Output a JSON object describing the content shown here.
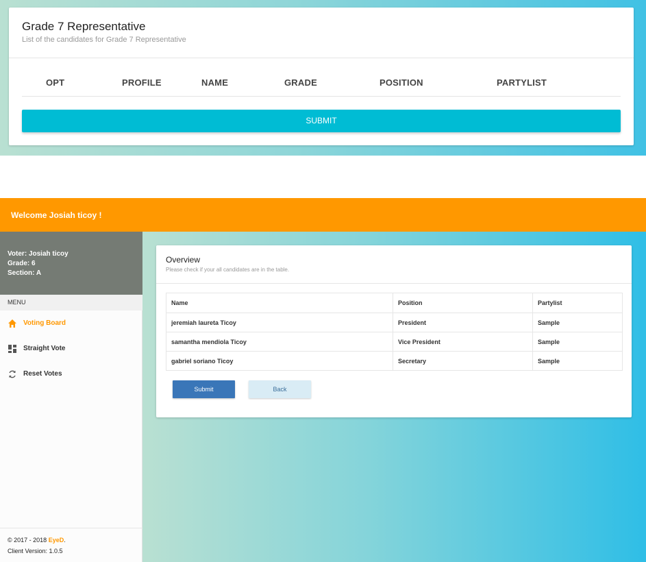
{
  "candidates_card": {
    "title": "Grade 7 Representative",
    "subtitle": "List of the candidates for Grade 7 Representative",
    "columns": [
      "OPT",
      "PROFILE",
      "NAME",
      "GRADE",
      "POSITION",
      "PARTYLIST"
    ],
    "submit_label": "SUBMIT"
  },
  "header": {
    "welcome": "Welcome Josiah ticoy !"
  },
  "sidebar": {
    "voter": "Voter: Josiah ticoy",
    "grade": "Grade: 6",
    "section": "Section: A",
    "menu_label": "MENU",
    "items": [
      {
        "label": "Voting Board",
        "icon": "home-icon",
        "active": true
      },
      {
        "label": "Straight Vote",
        "icon": "dashboard-icon",
        "active": false
      },
      {
        "label": "Reset Votes",
        "icon": "refresh-icon",
        "active": false
      }
    ],
    "footer": {
      "copyright": "© 2017 - 2018 ",
      "brand": "EyeD",
      "period": ".",
      "version": "Client Version: 1.0.5"
    }
  },
  "overview": {
    "title": "Overview",
    "subtitle": "Please check if your all candidates are in the table.",
    "table": {
      "headers": [
        "Name",
        "Position",
        "Partylist"
      ],
      "rows": [
        [
          "jeremiah laureta Ticoy",
          "President",
          "Sample"
        ],
        [
          "samantha mendiola Ticoy",
          "Vice President",
          "Sample"
        ],
        [
          "gabriel soriano Ticoy",
          "Secretary",
          "Sample"
        ]
      ]
    },
    "submit_label": "Submit",
    "back_label": "Back"
  },
  "colors": {
    "accent_orange": "#ff9800",
    "cyan": "#00bcd4",
    "blue_button": "#3a76b8"
  }
}
